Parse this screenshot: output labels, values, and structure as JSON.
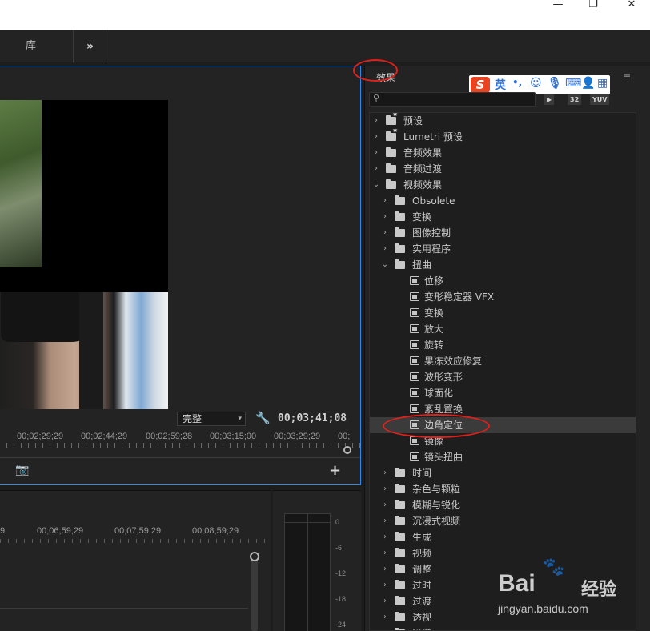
{
  "window": {
    "minimize_glyph": "—",
    "restore_glyph": "❐",
    "close_glyph": "✕"
  },
  "workspace": {
    "tab_label": "库",
    "more_glyph": "»"
  },
  "program_monitor": {
    "quality": "完整",
    "timecode": "00;03;41;08",
    "ruler_labels": [
      "00;02;29;29",
      "00;02;44;29",
      "00;02;59;28",
      "00;03;15;00",
      "00;03;29;29",
      "00;"
    ]
  },
  "timeline": {
    "ruler_labels": [
      "9",
      "00;06;59;29",
      "00;07;59;29",
      "00;08;59;29"
    ]
  },
  "audio_meter": {
    "db_labels": [
      "0",
      "-6",
      "-12",
      "-18",
      "-24"
    ]
  },
  "effects_panel": {
    "title": "效果",
    "ime_toolbar": {
      "logo": "S",
      "lang": "英",
      "punct": "•,"
    },
    "filters": [
      "32",
      "YUV"
    ],
    "tree": [
      {
        "label": "预设",
        "level": 0,
        "type": "folder",
        "expanded": false,
        "starred": true
      },
      {
        "label": "Lumetri 预设",
        "level": 0,
        "type": "folder",
        "expanded": false,
        "starred": true
      },
      {
        "label": "音频效果",
        "level": 0,
        "type": "folder",
        "expanded": false
      },
      {
        "label": "音频过渡",
        "level": 0,
        "type": "folder",
        "expanded": false
      },
      {
        "label": "视频效果",
        "level": 0,
        "type": "folder",
        "expanded": true
      },
      {
        "label": "Obsolete",
        "level": 1,
        "type": "folder",
        "expanded": false
      },
      {
        "label": "变换",
        "level": 1,
        "type": "folder",
        "expanded": false
      },
      {
        "label": "图像控制",
        "level": 1,
        "type": "folder",
        "expanded": false
      },
      {
        "label": "实用程序",
        "level": 1,
        "type": "folder",
        "expanded": false
      },
      {
        "label": "扭曲",
        "level": 1,
        "type": "folder",
        "expanded": true
      },
      {
        "label": "位移",
        "level": 2,
        "type": "effect"
      },
      {
        "label": "变形稳定器 VFX",
        "level": 2,
        "type": "effect"
      },
      {
        "label": "变换",
        "level": 2,
        "type": "effect"
      },
      {
        "label": "放大",
        "level": 2,
        "type": "effect"
      },
      {
        "label": "旋转",
        "level": 2,
        "type": "effect"
      },
      {
        "label": "果冻效应修复",
        "level": 2,
        "type": "effect"
      },
      {
        "label": "波形变形",
        "level": 2,
        "type": "effect"
      },
      {
        "label": "球面化",
        "level": 2,
        "type": "effect"
      },
      {
        "label": "紊乱置换",
        "level": 2,
        "type": "effect"
      },
      {
        "label": "边角定位",
        "level": 2,
        "type": "effect",
        "selected": true
      },
      {
        "label": "镜像",
        "level": 2,
        "type": "effect"
      },
      {
        "label": "镜头扭曲",
        "level": 2,
        "type": "effect"
      },
      {
        "label": "时间",
        "level": 1,
        "type": "folder",
        "expanded": false
      },
      {
        "label": "杂色与颗粒",
        "level": 1,
        "type": "folder",
        "expanded": false
      },
      {
        "label": "模糊与锐化",
        "level": 1,
        "type": "folder",
        "expanded": false
      },
      {
        "label": "沉浸式视频",
        "level": 1,
        "type": "folder",
        "expanded": false
      },
      {
        "label": "生成",
        "level": 1,
        "type": "folder",
        "expanded": false
      },
      {
        "label": "视频",
        "level": 1,
        "type": "folder",
        "expanded": false
      },
      {
        "label": "调整",
        "level": 1,
        "type": "folder",
        "expanded": false
      },
      {
        "label": "过时",
        "level": 1,
        "type": "folder",
        "expanded": false
      },
      {
        "label": "过渡",
        "level": 1,
        "type": "folder",
        "expanded": false
      },
      {
        "label": "透视",
        "level": 1,
        "type": "folder",
        "expanded": false
      },
      {
        "label": "通道",
        "level": 1,
        "type": "folder",
        "expanded": false
      }
    ]
  },
  "watermark": {
    "brand": "Bai",
    "brand2": "经验",
    "url": "jingyan.baidu.com"
  },
  "colors": {
    "panel_bg": "#232323",
    "accent_blue": "#2d8ceb",
    "annotation_red": "#e0201b"
  }
}
